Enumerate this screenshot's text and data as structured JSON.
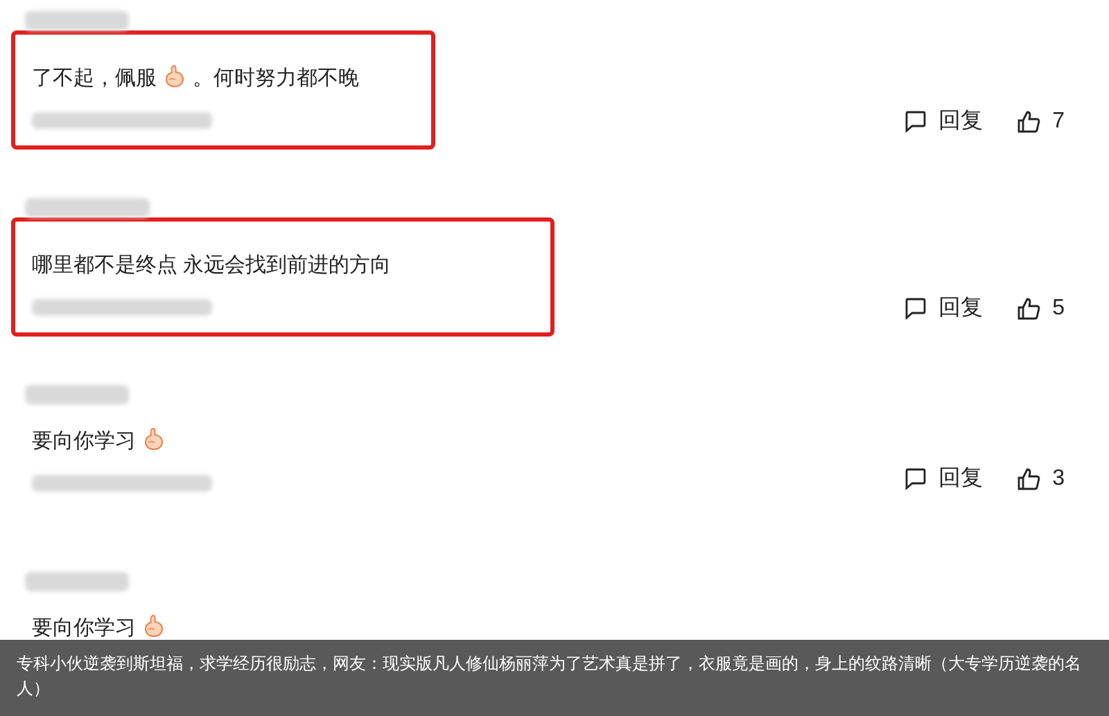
{
  "comments": [
    {
      "highlighted": true,
      "text": "了不起，佩服",
      "emoji": true,
      "text_after": "。何时努力都不晚",
      "reply": "回复",
      "likes": "7"
    },
    {
      "highlighted": true,
      "text": "哪里都不是终点 永远会找到前进的方向",
      "emoji": false,
      "reply": "回复",
      "likes": "5"
    },
    {
      "highlighted": false,
      "text": "要向你学习",
      "emoji": true,
      "reply": "回复",
      "likes": "3"
    },
    {
      "highlighted": false,
      "text": "要向你学习",
      "emoji": true
    }
  ],
  "caption": "专科小伙逆袭到斯坦福，求学经历很励志，网友：现实版凡人修仙杨丽萍为了艺术真是拼了，衣服竟是画的，身上的纹路清晰（大专学历逆袭的名人）"
}
